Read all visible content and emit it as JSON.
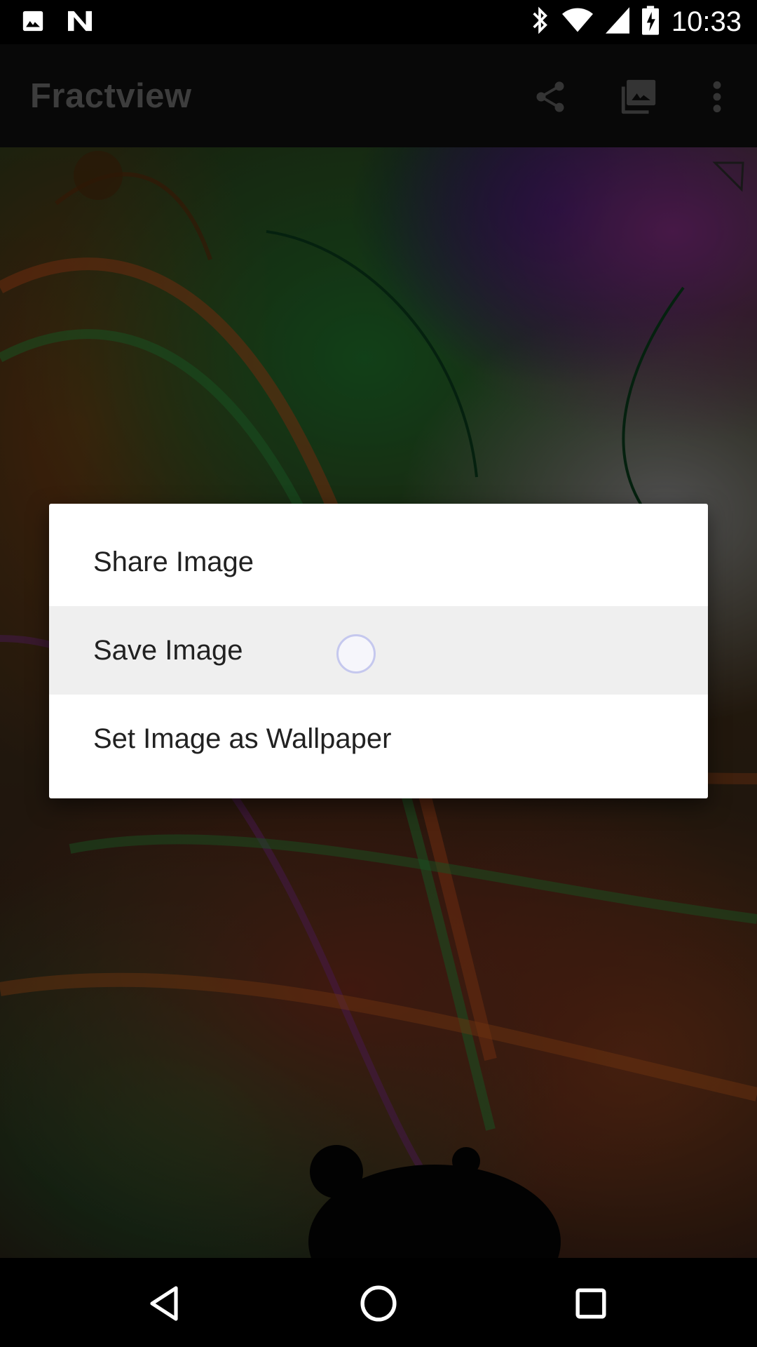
{
  "status_bar": {
    "time": "10:33",
    "icons_left": [
      "image-icon",
      "n-notification-icon"
    ],
    "icons_right": [
      "bluetooth-icon",
      "wifi-icon",
      "signal-icon",
      "battery-charging-icon"
    ]
  },
  "app_bar": {
    "title": "Fractview",
    "actions": [
      "share-icon",
      "gallery-icon",
      "overflow-menu-icon"
    ]
  },
  "dialog": {
    "items": [
      {
        "label": "Share Image"
      },
      {
        "label": "Save Image",
        "pressed": true
      },
      {
        "label": "Set Image as Wallpaper"
      }
    ]
  },
  "nav_bar": {
    "buttons": [
      "back-icon",
      "home-icon",
      "recents-icon"
    ]
  },
  "colors": {
    "dialog_bg": "#ffffff",
    "pressed_bg": "#efefef",
    "title_text": "#6a6a6a"
  }
}
